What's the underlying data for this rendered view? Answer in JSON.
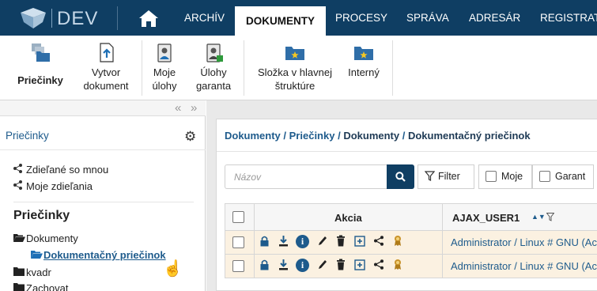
{
  "app": {
    "env_label": "DEV"
  },
  "nav": {
    "tabs": [
      {
        "label": "ARCHÍV"
      },
      {
        "label": "DOKUMENTY"
      },
      {
        "label": "PROCESY"
      },
      {
        "label": "SPRÁVA"
      },
      {
        "label": "ADRESÁR"
      },
      {
        "label": "REGISTRAT"
      }
    ]
  },
  "ribbon": {
    "buttons": [
      {
        "label": "Priečinky",
        "icon": "folders-icon"
      },
      {
        "label_line1": "Vytvor",
        "label_line2": "dokument",
        "icon": "create-document-icon"
      },
      {
        "label_line1": "Moje",
        "label_line2": "úlohy",
        "icon": "my-tasks-icon"
      },
      {
        "label_line1": "Úlohy",
        "label_line2": "garanta",
        "icon": "guarantor-tasks-icon"
      },
      {
        "label_line1": "Složka v hlavnej",
        "label_line2": "štruktúre",
        "icon": "main-folder-star-icon"
      },
      {
        "label": "Interný",
        "icon": "internal-folder-star-icon"
      }
    ]
  },
  "left_panel": {
    "title": "Priečinky",
    "share_items": [
      {
        "label": "Zdieľané so mnou"
      },
      {
        "label": "Moje zdieľania"
      }
    ],
    "folders_title": "Priečinky",
    "tree": [
      {
        "label": "Dokumenty"
      },
      {
        "label": "Dokumentačný priečinok"
      },
      {
        "label": "kvadr"
      },
      {
        "label": "Zachovat"
      }
    ]
  },
  "main": {
    "breadcrumb": {
      "part1": "Dokumenty",
      "sep": " / ",
      "part2": "Priečinky",
      "part3": "Dokumenty",
      "current": "Dokumentačný priečinok"
    },
    "search": {
      "placeholder": "Názov"
    },
    "filter_label": "Filter",
    "toggle_mine": "Moje",
    "toggle_guarantor": "Garant",
    "grid": {
      "col_actions": "Akcia",
      "col_user": "AJAX_USER1",
      "rows": [
        {
          "value": "Administrator / Linux # GNU (Ac"
        },
        {
          "value": "Administrator / Linux # GNU (Ac"
        }
      ]
    }
  },
  "colors": {
    "navy": "#0f3e63",
    "link": "#1e5b8c",
    "row_bg": "#fbf1e1"
  }
}
